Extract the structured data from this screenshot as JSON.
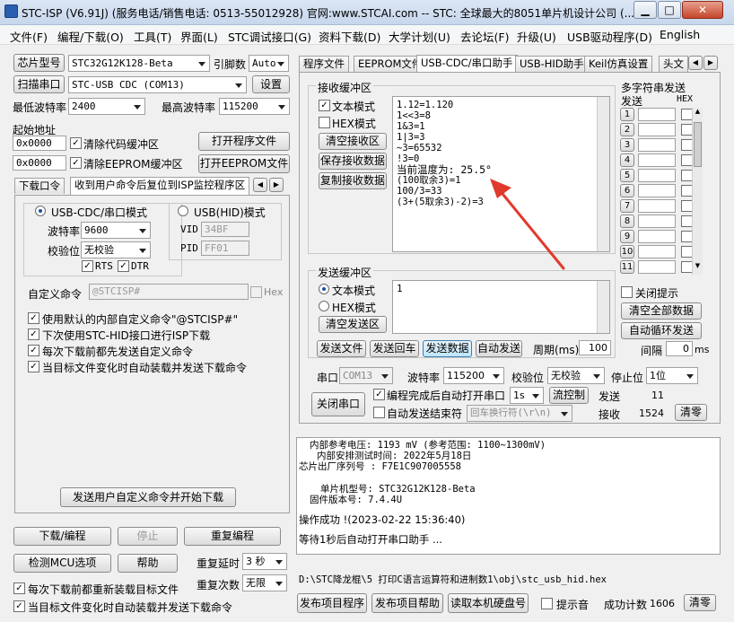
{
  "window": {
    "title": "STC-ISP (V6.91J) (服务电话/销售电话: 0513-55012928) 官网:www.STCAI.com -- STC: 全球最大的8051单片机设计公司 (...",
    "min": "▁",
    "max": "□",
    "close": "✕"
  },
  "menu": [
    "文件(F)",
    "编程/下载(O)",
    "工具(T)",
    "界面(L)",
    "STC调试接口(G)",
    "资料下载(D)",
    "大学计划(U)",
    "去论坛(F)",
    "升级(U)",
    "USB驱动程序(D)",
    "English"
  ],
  "left": {
    "chip_btn": "芯片型号",
    "chip_val": "STC32G12K128-Beta",
    "pin_lbl": "引脚数",
    "pin_val": "Auto",
    "scan_btn": "扫描串口",
    "port_val": "STC-USB CDC (COM13)",
    "settings_btn": "设置",
    "minbaud_lbl": "最低波特率",
    "minbaud_val": "2400",
    "maxbaud_lbl": "最高波特率",
    "maxbaud_val": "115200",
    "start_addr": "起始地址",
    "addr1": "0x0000",
    "clear_code": "清除代码缓冲区",
    "open_prog": "打开程序文件",
    "addr2": "0x0000",
    "clear_eeprom": "清除EEPROM缓冲区",
    "open_eeprom": "打开EEPROM文件",
    "tabs": [
      "下载口令",
      "收到用户命令后复位到ISP监控程序区"
    ],
    "usbcdc": "USB-CDC/串口模式",
    "usbhid": "USB(HID)模式",
    "baud_lbl": "波特率",
    "baud_val": "9600",
    "parity_lbl": "校验位",
    "parity_val": "无校验",
    "rts": "RTS",
    "dtr": "DTR",
    "vid_lbl": "VID",
    "vid_val": "34BF",
    "pid_lbl": "PID",
    "pid_val": "FF01",
    "custom_lbl": "自定义命令",
    "custom_val": "@STCISP#",
    "hex_lbl": "Hex",
    "opts": [
      "使用默认的内部自定义命令\"@STCISP#\"",
      "下次使用STC-HID接口进行ISP下载",
      "每次下载前都先发送自定义命令",
      "当目标文件变化时自动装载并发送下载命令"
    ],
    "send_custom_btn": "发送用户自定义命令并开始下载",
    "download_btn": "下载/编程",
    "stop_btn": "停止",
    "reprog_btn": "重复编程",
    "check_btn": "检测MCU选项",
    "help_btn": "帮助",
    "delay_lbl": "重复延时",
    "delay_val": "3 秒",
    "reload_lbl": "每次下载前都重新装载目标文件",
    "count_lbl": "重复次数",
    "count_val": "无限",
    "auto_lbl": "当目标文件变化时自动装载并发送下载命令"
  },
  "right": {
    "tabs": [
      "程序文件",
      "EEPROM文件",
      "USB-CDC/串口助手",
      "USB-HID助手",
      "Keil仿真设置",
      "头文"
    ],
    "recv_title": "接收缓冲区",
    "text_mode": "文本模式",
    "hex_mode": "HEX模式",
    "clear_recv": "清空接收区",
    "save_recv": "保存接收数据",
    "copy_recv": "复制接收数据",
    "recv_lines": [
      "1.12=1.120",
      "1<<3=8",
      "1&3=1",
      "1|3=3",
      "~3=65532",
      "!3=0",
      "当前温度为: 25.5°",
      "(100取余3)=1",
      "100/3=33",
      "(3+(5取余3)-2)=3"
    ],
    "multi_title": "多字符串发送",
    "send_col": "发送",
    "hex_col": "HEX",
    "multi_rows": [
      "1",
      "2",
      "3",
      "4",
      "5",
      "6",
      "7",
      "8",
      "9",
      "10",
      "11"
    ],
    "close_tip": "关闭提示",
    "clear_all": "清空全部数据",
    "auto_loop": "自动循环发送",
    "interval_lbl": "间隔",
    "interval_val": "0",
    "ms": "ms",
    "send_title": "发送缓冲区",
    "send_text": "1",
    "send_text_mode": "文本模式",
    "send_hex_mode": "HEX模式",
    "clear_send": "清空发送区",
    "send_file": "发送文件",
    "send_return": "发送回车",
    "send_data": "发送数据",
    "auto_send": "自动发送",
    "period_lbl": "周期(ms)",
    "period_val": "100",
    "port_lbl": "串口",
    "port_val": "COM13",
    "baud_lbl": "波特率",
    "baud_val": "115200",
    "parity_lbl": "校验位",
    "parity_val": "无校验",
    "stop_lbl": "停止位",
    "stop_val": "1位",
    "close_port": "关闭串口",
    "auto_open": "编程完成后自动打开串口",
    "auto_open_val": "1s",
    "flow": "流控制",
    "sent_lbl": "发送",
    "sent_val": "11",
    "auto_end": "自动发送结束符",
    "end_val": "回车换行符(\\r\\n)",
    "recv_lbl": "接收",
    "recv_val": "1524",
    "clear_btn": "清零"
  },
  "log": [
    "内部参考电压: 1193 mV (参考范围: 1100~1300mV)",
    "内部安排测试时间: 2022年5月18日",
    "芯片出厂序列号 : F7E1C907005558",
    "",
    "单片机型号: STC32G12K128-Beta",
    "固件版本号: 7.4.4U",
    "",
    "操作成功 !(2023-02-22 15:36:40)",
    "",
    "等待1秒后自动打开串口助手 ..."
  ],
  "path": "D:\\STC降龙棍\\5 打印C语言运算符和进制数1\\obj\\stc_usb_hid.hex",
  "bottom": {
    "publish": "发布项目程序",
    "publish_help": "发布项目帮助",
    "read_disk": "读取本机硬盘号",
    "beep": "提示音",
    "success_lbl": "成功计数",
    "success_val": "1606",
    "reset": "清零"
  },
  "colors": {
    "arrow": "#e03a2c",
    "accent": "#3c7fb1"
  }
}
